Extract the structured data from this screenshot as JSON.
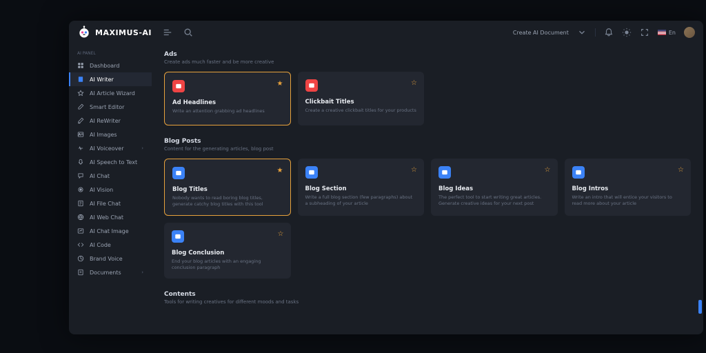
{
  "brand": "MAXIMUS-AI",
  "header": {
    "createDoc": "Create AI Document",
    "lang": "En"
  },
  "sidebar": {
    "section": "AI PANEL",
    "items": [
      {
        "label": "Dashboard"
      },
      {
        "label": "AI Writer",
        "active": true
      },
      {
        "label": "AI Article Wizard"
      },
      {
        "label": "Smart Editor"
      },
      {
        "label": "AI ReWriter"
      },
      {
        "label": "AI Images"
      },
      {
        "label": "AI Voiceover",
        "chev": true
      },
      {
        "label": "AI Speech to Text"
      },
      {
        "label": "AI Chat"
      },
      {
        "label": "AI Vision"
      },
      {
        "label": "AI File Chat"
      },
      {
        "label": "AI Web Chat"
      },
      {
        "label": "AI Chat Image"
      },
      {
        "label": "AI Code"
      },
      {
        "label": "Brand Voice"
      },
      {
        "label": "Documents",
        "chev": true
      }
    ]
  },
  "sections": [
    {
      "title": "Ads",
      "sub": "Create ads much faster and be more creative",
      "cards": [
        {
          "title": "Ad Headlines",
          "desc": "Write an attention grabbing ad headlines",
          "color": "red",
          "sel": true
        },
        {
          "title": "Clickbait Titles",
          "desc": "Create a creative clickbait titles for your products",
          "color": "red"
        }
      ]
    },
    {
      "title": "Blog Posts",
      "sub": "Content for the generating articles, blog post",
      "cards": [
        {
          "title": "Blog Titles",
          "desc": "Nobody wants to read boring blog titles, generate catchy blog titles with this tool",
          "color": "blue",
          "sel": true
        },
        {
          "title": "Blog Section",
          "desc": "Write a full blog section (few paragraphs) about a subheading of your article",
          "color": "blue"
        },
        {
          "title": "Blog Ideas",
          "desc": "The perfect tool to start writing great articles. Generate creative ideas for your next post",
          "color": "blue"
        },
        {
          "title": "Blog Intros",
          "desc": "Write an intro that will entice your visitors to read more about your article",
          "color": "blue"
        },
        {
          "title": "Blog Conclusion",
          "desc": "End your blog articles with an engaging conclusion paragraph",
          "color": "blue"
        }
      ]
    },
    {
      "title": "Contents",
      "sub": "Tools for writing creatives for different moods and tasks",
      "cards": []
    }
  ]
}
